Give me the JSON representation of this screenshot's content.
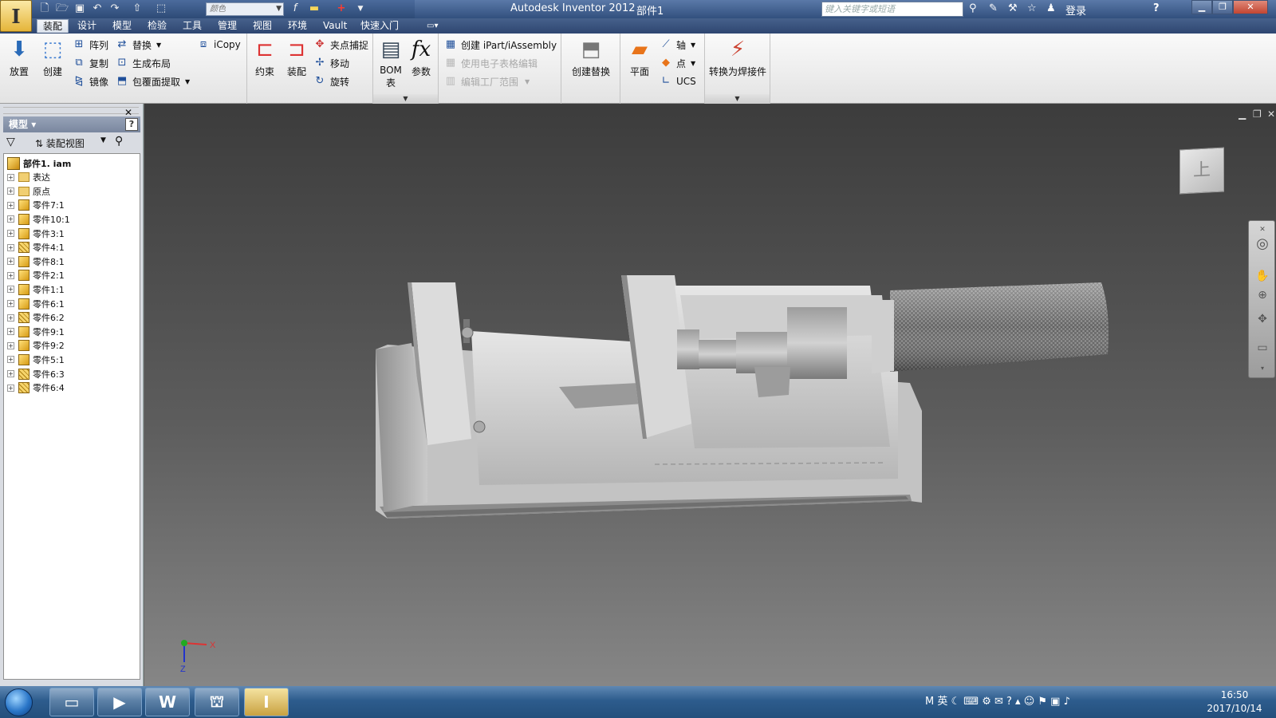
{
  "app": {
    "title": "Autodesk Inventor 2012",
    "document": "部件1"
  },
  "quick_access": {
    "color_value": "颜色",
    "search_placeholder": "键入关键字或短语",
    "login": "登录"
  },
  "menu_tabs": [
    "装配",
    "设计",
    "模型",
    "检验",
    "工具",
    "管理",
    "视图",
    "环境",
    "Vault",
    "快速入门"
  ],
  "ribbon": {
    "place": "放置",
    "create": "创建",
    "pattern": "阵列",
    "copy": "复制",
    "mirror": "镜像",
    "replace": "替换",
    "generate_layout": "生成布局",
    "shrinkwrap": "包覆面提取",
    "icopy": "iCopy",
    "constrain": "约束",
    "assemble": "装配",
    "grip_snap": "夹点捕捉",
    "move": "移动",
    "rotate": "旋转",
    "bom": "BOM",
    "bom2": "表",
    "params": "参数",
    "create_ipart": "创建 iPart/iAssembly",
    "use_spreadsheet": "使用电子表格编辑",
    "edit_factory": "编辑工厂范围",
    "create_substitute": "创建替换",
    "plane": "平面",
    "axis": "轴",
    "point": "点",
    "ucs": "UCS",
    "convert_weldment": "转换为焊接件"
  },
  "browser": {
    "title": "模型",
    "view": "装配视图",
    "help": "?",
    "nodes": [
      {
        "label": "部件1. iam",
        "type": "root"
      },
      {
        "label": "表达",
        "type": "folder"
      },
      {
        "label": "原点",
        "type": "folder"
      },
      {
        "label": "零件7:1",
        "type": "part"
      },
      {
        "label": "零件10:1",
        "type": "part"
      },
      {
        "label": "零件3:1",
        "type": "part"
      },
      {
        "label": "零件4:1",
        "type": "hatch"
      },
      {
        "label": "零件8:1",
        "type": "part"
      },
      {
        "label": "零件2:1",
        "type": "part"
      },
      {
        "label": "零件1:1",
        "type": "part"
      },
      {
        "label": "零件6:1",
        "type": "part"
      },
      {
        "label": "零件6:2",
        "type": "hatch"
      },
      {
        "label": "零件9:1",
        "type": "part"
      },
      {
        "label": "零件9:2",
        "type": "part"
      },
      {
        "label": "零件5:1",
        "type": "part"
      },
      {
        "label": "零件6:3",
        "type": "hatch"
      },
      {
        "label": "零件6:4",
        "type": "hatch"
      }
    ]
  },
  "viewport": {
    "viewcube_face": "上",
    "axis_x": "X",
    "axis_z": "Z"
  },
  "tray": {
    "ime": "英",
    "time": "16:50",
    "date": "2017/10/14"
  },
  "colors": {
    "accent": "#2e4671",
    "viewport_top": "#3c3c3c",
    "part_icon": "#e5b53a"
  }
}
